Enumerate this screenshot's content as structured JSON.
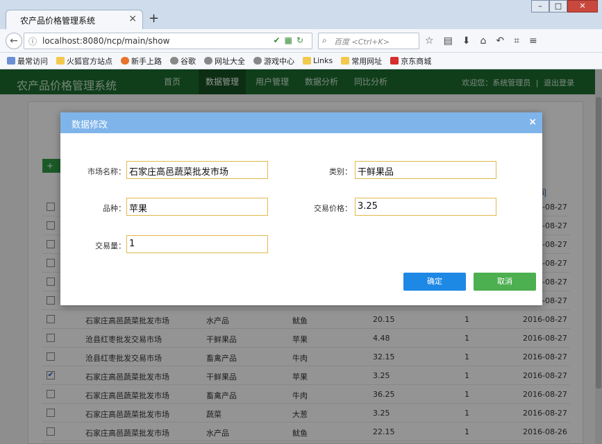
{
  "browser": {
    "tab_title": "农产品价格管理系统",
    "tab_close": "×",
    "new_tab": "+",
    "url": "localhost:8080/ncp/main/show",
    "search_placeholder": "百度 <Ctrl+K>",
    "bookmarks": [
      "最常访问",
      "火狐官方站点",
      "新手上路",
      "谷歌",
      "网址大全",
      "游戏中心",
      "Links",
      "常用网址",
      "京东商城"
    ]
  },
  "app": {
    "title": "农产品价格管理系统",
    "nav": [
      "首页",
      "数据管理",
      "用户管理",
      "数据分析",
      "同比分析"
    ],
    "active_nav": "数据管理",
    "welcome": "欢迎您：系统管理员",
    "logout": "退出登录",
    "add_label": "+",
    "date_header": "间"
  },
  "table": {
    "rows": [
      {
        "checked": false,
        "market": "",
        "category": "",
        "variety": "",
        "price": "",
        "qty": "",
        "date": "2016-08-27"
      },
      {
        "checked": false,
        "market": "",
        "category": "",
        "variety": "",
        "price": "",
        "qty": "",
        "date": "2016-08-27"
      },
      {
        "checked": false,
        "market": "",
        "category": "",
        "variety": "",
        "price": "",
        "qty": "",
        "date": "2016-08-27"
      },
      {
        "checked": false,
        "market": "",
        "category": "",
        "variety": "",
        "price": "",
        "qty": "",
        "date": "2016-08-27"
      },
      {
        "checked": false,
        "market": "",
        "category": "",
        "variety": "",
        "price": "",
        "qty": "",
        "date": "2016-08-27"
      },
      {
        "checked": false,
        "market": "",
        "category": "",
        "variety": "",
        "price": "",
        "qty": "",
        "date": "2016-08-27"
      },
      {
        "checked": false,
        "market": "石家庄高邑蔬菜批发市场",
        "category": "水产品",
        "variety": "鱿鱼",
        "price": "20.15",
        "qty": "1",
        "date": "2016-08-27"
      },
      {
        "checked": false,
        "market": "沧县红枣批发交易市场",
        "category": "干鲜果品",
        "variety": "苹果",
        "price": "4.48",
        "qty": "1",
        "date": "2016-08-27"
      },
      {
        "checked": false,
        "market": "沧县红枣批发交易市场",
        "category": "畜禽产品",
        "variety": "牛肉",
        "price": "32.15",
        "qty": "1",
        "date": "2016-08-27"
      },
      {
        "checked": true,
        "market": "石家庄高邑蔬菜批发市场",
        "category": "干鲜果品",
        "variety": "苹果",
        "price": "3.25",
        "qty": "1",
        "date": "2016-08-27"
      },
      {
        "checked": false,
        "market": "石家庄高邑蔬菜批发市场",
        "category": "畜禽产品",
        "variety": "牛肉",
        "price": "36.25",
        "qty": "1",
        "date": "2016-08-27"
      },
      {
        "checked": false,
        "market": "石家庄高邑蔬菜批发市场",
        "category": "蔬菜",
        "variety": "大葱",
        "price": "3.25",
        "qty": "1",
        "date": "2016-08-27"
      },
      {
        "checked": false,
        "market": "石家庄高邑蔬菜批发市场",
        "category": "水产品",
        "variety": "鱿鱼",
        "price": "22.15",
        "qty": "1",
        "date": "2016-08-26"
      }
    ]
  },
  "modal": {
    "title": "数据修改",
    "close": "×",
    "market_label": "市场名称：",
    "market_value": "石家庄高邑蔬菜批发市场",
    "category_label": "类别：",
    "category_value": "干鲜果品",
    "variety_label": "品种：",
    "variety_value": "苹果",
    "price_label": "交易价格：",
    "price_value": "3.25",
    "qty_label": "交易量：",
    "qty_value": "1",
    "confirm": "确定",
    "cancel": "取消"
  }
}
